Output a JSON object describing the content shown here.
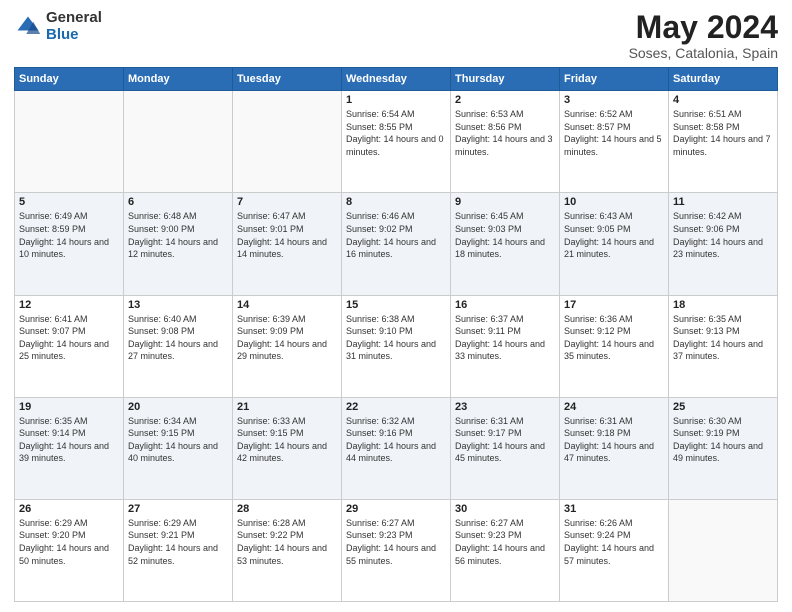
{
  "logo": {
    "general": "General",
    "blue": "Blue"
  },
  "title": {
    "month_year": "May 2024",
    "location": "Soses, Catalonia, Spain"
  },
  "calendar": {
    "headers": [
      "Sunday",
      "Monday",
      "Tuesday",
      "Wednesday",
      "Thursday",
      "Friday",
      "Saturday"
    ],
    "rows": [
      [
        {
          "day": "",
          "empty": true
        },
        {
          "day": "",
          "empty": true
        },
        {
          "day": "",
          "empty": true
        },
        {
          "day": "1",
          "sunrise": "Sunrise: 6:54 AM",
          "sunset": "Sunset: 8:55 PM",
          "daylight": "Daylight: 14 hours and 0 minutes."
        },
        {
          "day": "2",
          "sunrise": "Sunrise: 6:53 AM",
          "sunset": "Sunset: 8:56 PM",
          "daylight": "Daylight: 14 hours and 3 minutes."
        },
        {
          "day": "3",
          "sunrise": "Sunrise: 6:52 AM",
          "sunset": "Sunset: 8:57 PM",
          "daylight": "Daylight: 14 hours and 5 minutes."
        },
        {
          "day": "4",
          "sunrise": "Sunrise: 6:51 AM",
          "sunset": "Sunset: 8:58 PM",
          "daylight": "Daylight: 14 hours and 7 minutes."
        }
      ],
      [
        {
          "day": "5",
          "sunrise": "Sunrise: 6:49 AM",
          "sunset": "Sunset: 8:59 PM",
          "daylight": "Daylight: 14 hours and 10 minutes."
        },
        {
          "day": "6",
          "sunrise": "Sunrise: 6:48 AM",
          "sunset": "Sunset: 9:00 PM",
          "daylight": "Daylight: 14 hours and 12 minutes."
        },
        {
          "day": "7",
          "sunrise": "Sunrise: 6:47 AM",
          "sunset": "Sunset: 9:01 PM",
          "daylight": "Daylight: 14 hours and 14 minutes."
        },
        {
          "day": "8",
          "sunrise": "Sunrise: 6:46 AM",
          "sunset": "Sunset: 9:02 PM",
          "daylight": "Daylight: 14 hours and 16 minutes."
        },
        {
          "day": "9",
          "sunrise": "Sunrise: 6:45 AM",
          "sunset": "Sunset: 9:03 PM",
          "daylight": "Daylight: 14 hours and 18 minutes."
        },
        {
          "day": "10",
          "sunrise": "Sunrise: 6:43 AM",
          "sunset": "Sunset: 9:05 PM",
          "daylight": "Daylight: 14 hours and 21 minutes."
        },
        {
          "day": "11",
          "sunrise": "Sunrise: 6:42 AM",
          "sunset": "Sunset: 9:06 PM",
          "daylight": "Daylight: 14 hours and 23 minutes."
        }
      ],
      [
        {
          "day": "12",
          "sunrise": "Sunrise: 6:41 AM",
          "sunset": "Sunset: 9:07 PM",
          "daylight": "Daylight: 14 hours and 25 minutes."
        },
        {
          "day": "13",
          "sunrise": "Sunrise: 6:40 AM",
          "sunset": "Sunset: 9:08 PM",
          "daylight": "Daylight: 14 hours and 27 minutes."
        },
        {
          "day": "14",
          "sunrise": "Sunrise: 6:39 AM",
          "sunset": "Sunset: 9:09 PM",
          "daylight": "Daylight: 14 hours and 29 minutes."
        },
        {
          "day": "15",
          "sunrise": "Sunrise: 6:38 AM",
          "sunset": "Sunset: 9:10 PM",
          "daylight": "Daylight: 14 hours and 31 minutes."
        },
        {
          "day": "16",
          "sunrise": "Sunrise: 6:37 AM",
          "sunset": "Sunset: 9:11 PM",
          "daylight": "Daylight: 14 hours and 33 minutes."
        },
        {
          "day": "17",
          "sunrise": "Sunrise: 6:36 AM",
          "sunset": "Sunset: 9:12 PM",
          "daylight": "Daylight: 14 hours and 35 minutes."
        },
        {
          "day": "18",
          "sunrise": "Sunrise: 6:35 AM",
          "sunset": "Sunset: 9:13 PM",
          "daylight": "Daylight: 14 hours and 37 minutes."
        }
      ],
      [
        {
          "day": "19",
          "sunrise": "Sunrise: 6:35 AM",
          "sunset": "Sunset: 9:14 PM",
          "daylight": "Daylight: 14 hours and 39 minutes."
        },
        {
          "day": "20",
          "sunrise": "Sunrise: 6:34 AM",
          "sunset": "Sunset: 9:15 PM",
          "daylight": "Daylight: 14 hours and 40 minutes."
        },
        {
          "day": "21",
          "sunrise": "Sunrise: 6:33 AM",
          "sunset": "Sunset: 9:15 PM",
          "daylight": "Daylight: 14 hours and 42 minutes."
        },
        {
          "day": "22",
          "sunrise": "Sunrise: 6:32 AM",
          "sunset": "Sunset: 9:16 PM",
          "daylight": "Daylight: 14 hours and 44 minutes."
        },
        {
          "day": "23",
          "sunrise": "Sunrise: 6:31 AM",
          "sunset": "Sunset: 9:17 PM",
          "daylight": "Daylight: 14 hours and 45 minutes."
        },
        {
          "day": "24",
          "sunrise": "Sunrise: 6:31 AM",
          "sunset": "Sunset: 9:18 PM",
          "daylight": "Daylight: 14 hours and 47 minutes."
        },
        {
          "day": "25",
          "sunrise": "Sunrise: 6:30 AM",
          "sunset": "Sunset: 9:19 PM",
          "daylight": "Daylight: 14 hours and 49 minutes."
        }
      ],
      [
        {
          "day": "26",
          "sunrise": "Sunrise: 6:29 AM",
          "sunset": "Sunset: 9:20 PM",
          "daylight": "Daylight: 14 hours and 50 minutes."
        },
        {
          "day": "27",
          "sunrise": "Sunrise: 6:29 AM",
          "sunset": "Sunset: 9:21 PM",
          "daylight": "Daylight: 14 hours and 52 minutes."
        },
        {
          "day": "28",
          "sunrise": "Sunrise: 6:28 AM",
          "sunset": "Sunset: 9:22 PM",
          "daylight": "Daylight: 14 hours and 53 minutes."
        },
        {
          "day": "29",
          "sunrise": "Sunrise: 6:27 AM",
          "sunset": "Sunset: 9:23 PM",
          "daylight": "Daylight: 14 hours and 55 minutes."
        },
        {
          "day": "30",
          "sunrise": "Sunrise: 6:27 AM",
          "sunset": "Sunset: 9:23 PM",
          "daylight": "Daylight: 14 hours and 56 minutes."
        },
        {
          "day": "31",
          "sunrise": "Sunrise: 6:26 AM",
          "sunset": "Sunset: 9:24 PM",
          "daylight": "Daylight: 14 hours and 57 minutes."
        },
        {
          "day": "",
          "empty": true
        }
      ]
    ]
  }
}
